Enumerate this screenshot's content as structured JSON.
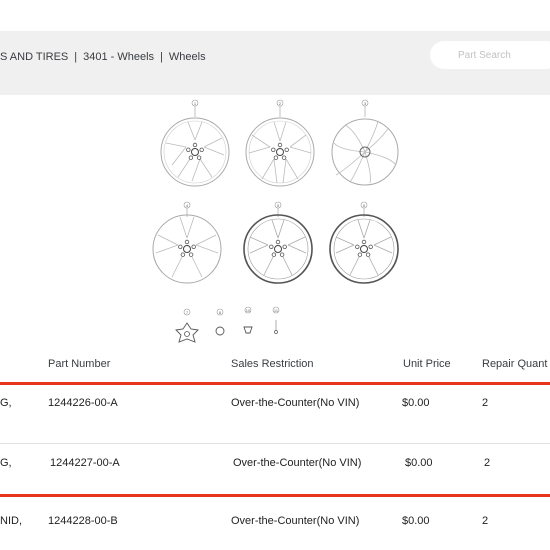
{
  "header": {
    "breadcrumb": {
      "category": "S AND TIRES",
      "group": "3401 - Wheels",
      "section": "Wheels",
      "separator": "|"
    },
    "search_placeholder": "Part Search"
  },
  "diagram": {
    "callouts": [
      "1",
      "2",
      "3",
      "4",
      "5",
      "6",
      "7",
      "8",
      "10",
      "11"
    ]
  },
  "table": {
    "columns": {
      "description": "",
      "part_number": "Part Number",
      "sales_restriction": "Sales Restriction",
      "unit_price": "Unit Price",
      "repair_quantity": "Repair Quant"
    },
    "rows": [
      {
        "description": "G,",
        "part_number": "1244226-00-A",
        "sales_restriction": "Over-the-Counter(No VIN)",
        "unit_price": "$0.00",
        "repair_quantity": "2"
      },
      {
        "description": "G,",
        "part_number": "1244227-00-A",
        "sales_restriction": "Over-the-Counter(No VIN)",
        "unit_price": "$0.00",
        "repair_quantity": "2"
      },
      {
        "description": "NID,",
        "part_number": "1244228-00-B",
        "sales_restriction": "Over-the-Counter(No VIN)",
        "unit_price": "$0.00",
        "repair_quantity": "2"
      }
    ]
  },
  "colors": {
    "highlight": "#e8341c",
    "header_bg": "#f0f0f0",
    "text": "#393c41"
  }
}
